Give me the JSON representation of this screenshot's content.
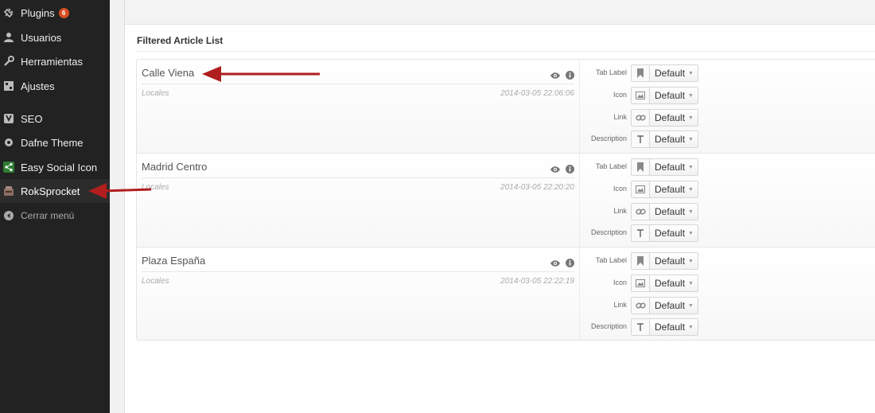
{
  "sidebar": {
    "items": [
      {
        "label": "Plugins",
        "icon": "plug-icon",
        "badge": "6"
      },
      {
        "label": "Usuarios",
        "icon": "user-icon"
      },
      {
        "label": "Herramientas",
        "icon": "wrench-icon"
      },
      {
        "label": "Ajustes",
        "icon": "settings-icon"
      },
      {
        "label": "SEO",
        "icon": "yoast-seo-icon"
      },
      {
        "label": "Dafne Theme",
        "icon": "gear-icon"
      },
      {
        "label": "Easy Social Icon",
        "icon": "share-icon"
      },
      {
        "label": "RokSprocket",
        "icon": "rocket-box-icon"
      }
    ],
    "collapse_label": "Cerrar menú"
  },
  "main": {
    "section_title": "Filtered Article List",
    "articles": [
      {
        "title": "Calle Viena",
        "category": "Locales",
        "date": "2014-03-05 22:06:06"
      },
      {
        "title": "Madrid Centro",
        "category": "Locales",
        "date": "2014-03-05 22:20:20"
      },
      {
        "title": "Plaza España",
        "category": "Locales",
        "date": "2014-03-05 22:22:19"
      }
    ],
    "field_labels": {
      "tab_label": "Tab Label",
      "icon": "Icon",
      "link": "Link",
      "description": "Description"
    },
    "default_value": "Default"
  },
  "colors": {
    "sidebar_bg": "#222222",
    "badge": "#d54e21",
    "annotation_arrow": "#b01e1e"
  }
}
